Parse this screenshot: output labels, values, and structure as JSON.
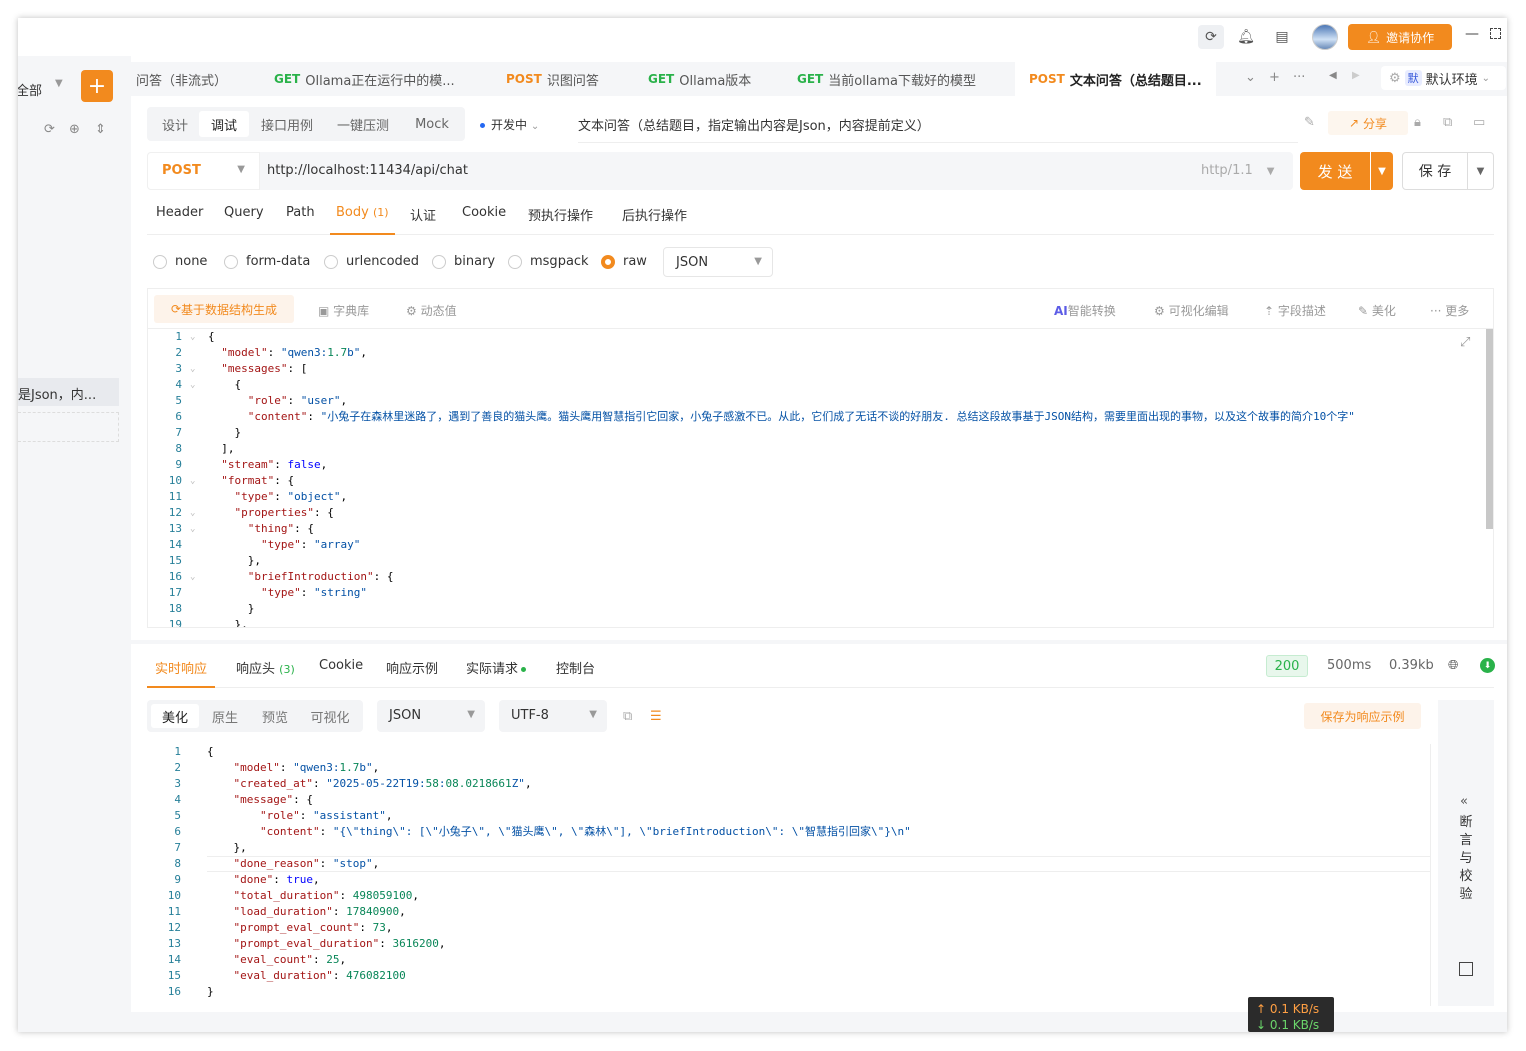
{
  "titlebar": {
    "invite_label": "邀请协作",
    "icons": [
      "refresh-icon",
      "bell-icon",
      "note-icon"
    ]
  },
  "left_panel": {
    "filter_label": "全部",
    "add_symbol": "+",
    "selected_item": "是Json，内..."
  },
  "tabs": [
    {
      "method": "",
      "label": "问答（非流式）"
    },
    {
      "method": "GET",
      "label": "Ollama正在运行中的模..."
    },
    {
      "method": "POST",
      "label": "识图问答"
    },
    {
      "method": "GET",
      "label": "Ollama版本"
    },
    {
      "method": "GET",
      "label": "当前ollama下载好的模型"
    },
    {
      "method": "POST",
      "label": "文本问答（总结题目..."
    }
  ],
  "environment": {
    "badge": "默",
    "label": "默认环境"
  },
  "modes": [
    "设计",
    "调试",
    "接口用例",
    "一键压测",
    "Mock"
  ],
  "active_mode": "调试",
  "status": "开发中",
  "request_name": "文本问答（总结题目，指定输出内容是Json，内容提前定义）",
  "share_label": "分享",
  "request": {
    "method": "POST",
    "url": "http://localhost:11434/api/chat",
    "protocol": "http/1.1",
    "send_label": "发 送",
    "save_label": "保 存"
  },
  "request_tabs": [
    {
      "label": "Header",
      "count": ""
    },
    {
      "label": "Query",
      "count": ""
    },
    {
      "label": "Path",
      "count": ""
    },
    {
      "label": "Body",
      "count": "(1)"
    },
    {
      "label": "认证",
      "count": ""
    },
    {
      "label": "Cookie",
      "count": ""
    },
    {
      "label": "预执行操作",
      "count": ""
    },
    {
      "label": "后执行操作",
      "count": ""
    }
  ],
  "body_types": [
    "none",
    "form-data",
    "urlencoded",
    "binary",
    "msgpack",
    "raw"
  ],
  "body_type_selected": "raw",
  "raw_format": "JSON",
  "editor_tools": {
    "generate": "基于数据结构生成",
    "dictionary": "字典库",
    "dynamic": "动态值",
    "ai_badge": "AI",
    "smart_convert": "智能转换",
    "visual_edit": "可视化编辑",
    "field_desc": "字段描述",
    "beautify": "美化",
    "more": "更多"
  },
  "request_body_lines": [
    "{",
    "  \"model\": \"qwen3:1.7b\",",
    "  \"messages\": [",
    "    {",
    "      \"role\": \"user\",",
    "      \"content\": \"小兔子在森林里迷路了，遇到了善良的猫头鹰。猫头鹰用智慧指引它回家，小兔子感激不已。从此，它们成了无话不谈的好朋友. 总结这段故事基于JSON结构，需要里面出现的事物，以及这个故事的简介10个字\"",
    "    }",
    "  ],",
    "  \"stream\": false,",
    "  \"format\": {",
    "    \"type\": \"object\",",
    "    \"properties\": {",
    "      \"thing\": {",
    "        \"type\": \"array\"",
    "      },",
    "      \"briefIntroduction\": {",
    "        \"type\": \"string\"",
    "      }",
    "    },"
  ],
  "response_tabs": [
    {
      "label": "实时响应",
      "count": ""
    },
    {
      "label": "响应头",
      "count": "(3)"
    },
    {
      "label": "Cookie",
      "count": ""
    },
    {
      "label": "响应示例",
      "count": ""
    },
    {
      "label": "实际请求",
      "count": ""
    },
    {
      "label": "控制台",
      "count": ""
    }
  ],
  "response_meta": {
    "status": "200",
    "time": "500ms",
    "size": "0.39kb"
  },
  "response_view_modes": [
    "美化",
    "原生",
    "预览",
    "可视化"
  ],
  "response_format": "JSON",
  "response_encoding": "UTF-8",
  "save_example_label": "保存为响应示例",
  "response_lines": [
    "{",
    "    \"model\": \"qwen3:1.7b\",",
    "    \"created_at\": \"2025-05-22T19:58:08.0218661Z\",",
    "    \"message\": {",
    "        \"role\": \"assistant\",",
    "        \"content\": \"{\\\"thing\\\": [\\\"小兔子\\\", \\\"猫头鹰\\\", \\\"森林\\\"], \\\"briefIntroduction\\\": \\\"智慧指引回家\\\"}\\n\"",
    "    },",
    "    \"done_reason\": \"stop\",",
    "    \"done\": true,",
    "    \"total_duration\": 498059100,",
    "    \"load_duration\": 17840900,",
    "    \"prompt_eval_count\": 73,",
    "    \"prompt_eval_duration\": 3616200,",
    "    \"eval_count\": 25,",
    "    \"eval_duration\": 476082100",
    "}"
  ],
  "assert_panel": {
    "label": "断言与校验"
  },
  "net_speed": {
    "up": "↑ 0.1 KB/s",
    "down": "↓ 0.1 KB/s"
  },
  "colors": {
    "accent": "#f28a1e",
    "get": "#2ab24a",
    "post": "#f28a1e"
  }
}
